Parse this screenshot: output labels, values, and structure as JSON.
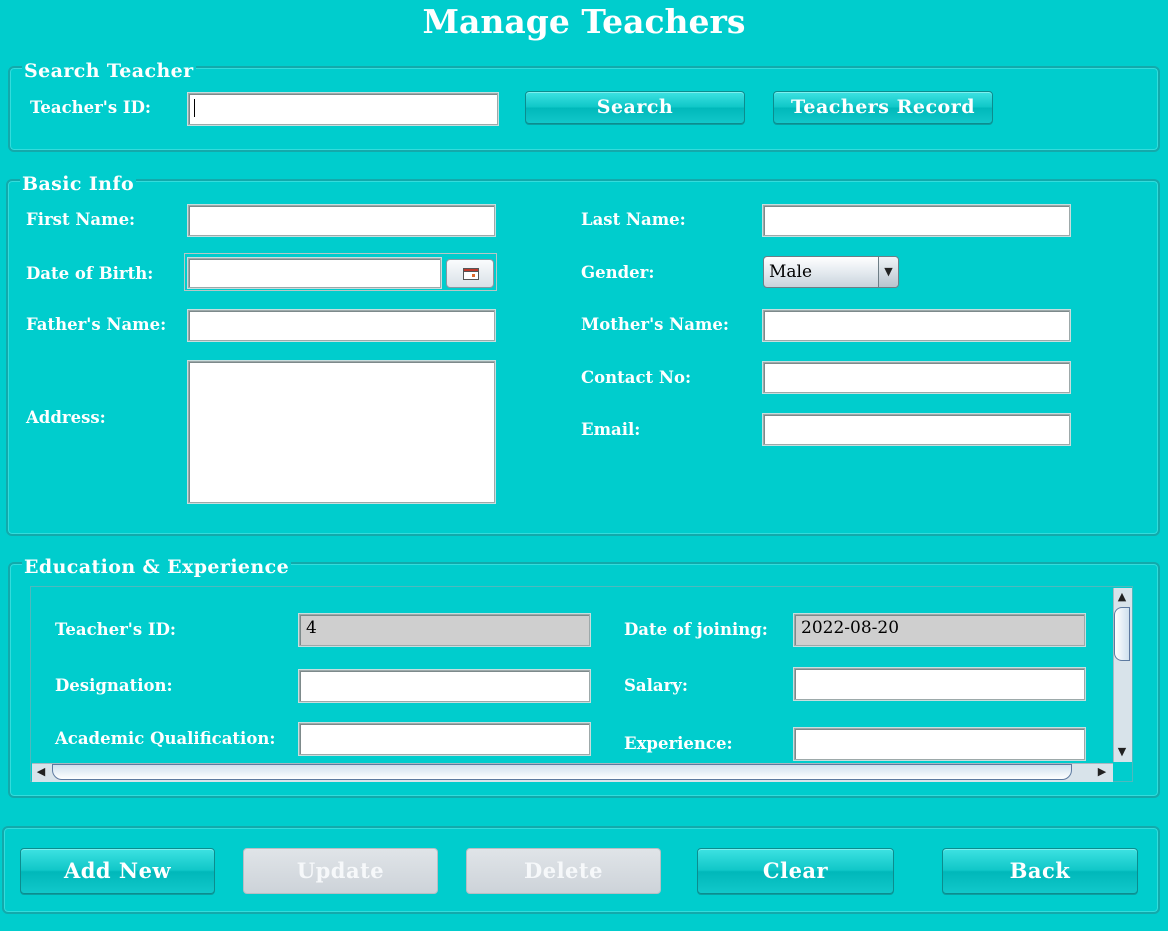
{
  "title": "Manage Teachers",
  "search": {
    "legend": "Search Teacher",
    "id_label": "Teacher's ID:",
    "id_value": "",
    "search_button": "Search",
    "record_button": "Teachers Record"
  },
  "basic": {
    "legend": "Basic Info",
    "first_name_label": "First Name:",
    "last_name_label": "Last Name:",
    "dob_label": "Date of Birth:",
    "gender_label": "Gender:",
    "gender_value": "Male",
    "father_label": "Father's Name:",
    "mother_label": "Mother's Name:",
    "contact_label": "Contact No:",
    "address_label": "Address:",
    "email_label": "Email:"
  },
  "education": {
    "legend": "Education & Experience",
    "id_label": "Teacher's ID:",
    "id_value": "4",
    "joining_label": "Date of joining:",
    "joining_value": "2022-08-20",
    "designation_label": "Designation:",
    "salary_label": "Salary:",
    "qualification_label": "Academic Qualification:",
    "experience_label": "Experience:"
  },
  "actions": {
    "add_new": "Add New",
    "update": "Update",
    "delete": "Delete",
    "clear": "Clear",
    "back": "Back"
  },
  "icons": {
    "calendar": "calendar-icon",
    "dropdown": "chevron-down-icon"
  }
}
